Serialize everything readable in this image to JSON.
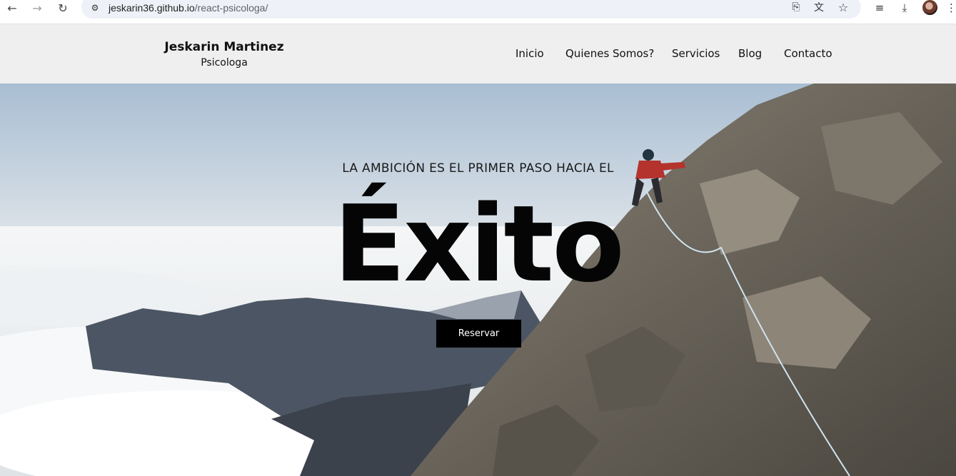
{
  "browser": {
    "url_host": "jeskarin36.github.io",
    "url_path": "/react-psicologa/",
    "icons": {
      "back": "arrow-left-icon",
      "forward": "arrow-right-icon",
      "reload": "reload-icon",
      "site_info": "tune-icon",
      "install": "install-app-icon",
      "translate": "translate-icon",
      "bookmark": "star-icon",
      "media": "media-control-icon",
      "downloads": "download-icon",
      "menu": "kebab-menu-icon"
    }
  },
  "header": {
    "brand_name": "Jeskarin Martinez",
    "brand_subtitle": "Psicologa",
    "nav": [
      "Inicio",
      "Quienes Somos?",
      "Servicios",
      "Blog",
      "Contacto"
    ]
  },
  "hero": {
    "tagline": "LA AMBICIÓN ES EL PRIMER PASO HACIA EL",
    "title": "Éxito",
    "button_label": "Reservar"
  },
  "colors": {
    "header_bg": "#efefef",
    "button_bg": "#000000",
    "button_text": "#ffffff",
    "title_text": "#050505"
  }
}
